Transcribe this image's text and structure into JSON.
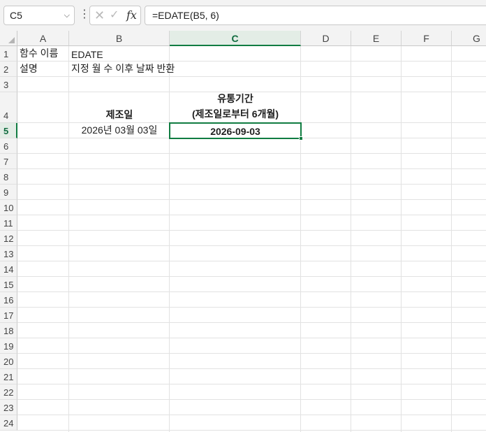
{
  "formula_bar": {
    "name_box": "C5",
    "formula": "=EDATE(B5, 6)",
    "icons": [
      "cancel-icon",
      "enter-icon",
      "function-icon"
    ]
  },
  "columns": [
    "A",
    "B",
    "C",
    "D",
    "E",
    "F",
    "G"
  ],
  "active_column": "C",
  "rows": [
    "1",
    "2",
    "3",
    "4",
    "5",
    "6",
    "7",
    "8",
    "9",
    "10",
    "11",
    "12",
    "13",
    "14",
    "15",
    "16",
    "17",
    "18",
    "19",
    "20",
    "21",
    "22",
    "23",
    "24"
  ],
  "active_row": "5",
  "cells": {
    "A1": "함수 이름",
    "B1": "EDATE",
    "A2": "설명",
    "B2": "지정 월 수 이후 날짜 반환",
    "B4": "제조일",
    "C4_line1": "유통기간",
    "C4_line2": "(제조일로부터 6개월)",
    "B5": "2026년 03월 03일",
    "C5": "2026-09-03"
  },
  "colors": {
    "selection": "#107c41",
    "header_bg": "#f3f3f3"
  }
}
